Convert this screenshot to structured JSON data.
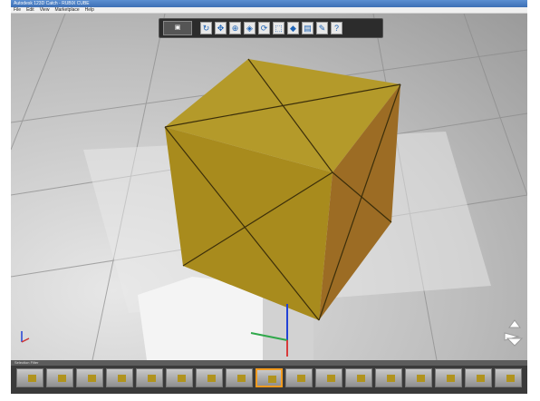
{
  "window": {
    "title": "Autodesk 123D Catch - RUBIX CUBE"
  },
  "menu": {
    "items": [
      "File",
      "Edit",
      "View",
      "Marketplace",
      "Help"
    ]
  },
  "toolbar": {
    "icons": [
      "camera-icon",
      "orbit-icon",
      "pan-icon",
      "zoom-icon",
      "fit-icon",
      "rotate-icon",
      "select-icon",
      "paint-icon",
      "measure-icon",
      "settings-icon",
      "help-icon"
    ]
  },
  "filmstrip": {
    "header_left": "Selection Filter",
    "header_right": "",
    "thumb_count": 17
  },
  "scene": {
    "object": "cube",
    "cube_color": "#b0931e"
  }
}
